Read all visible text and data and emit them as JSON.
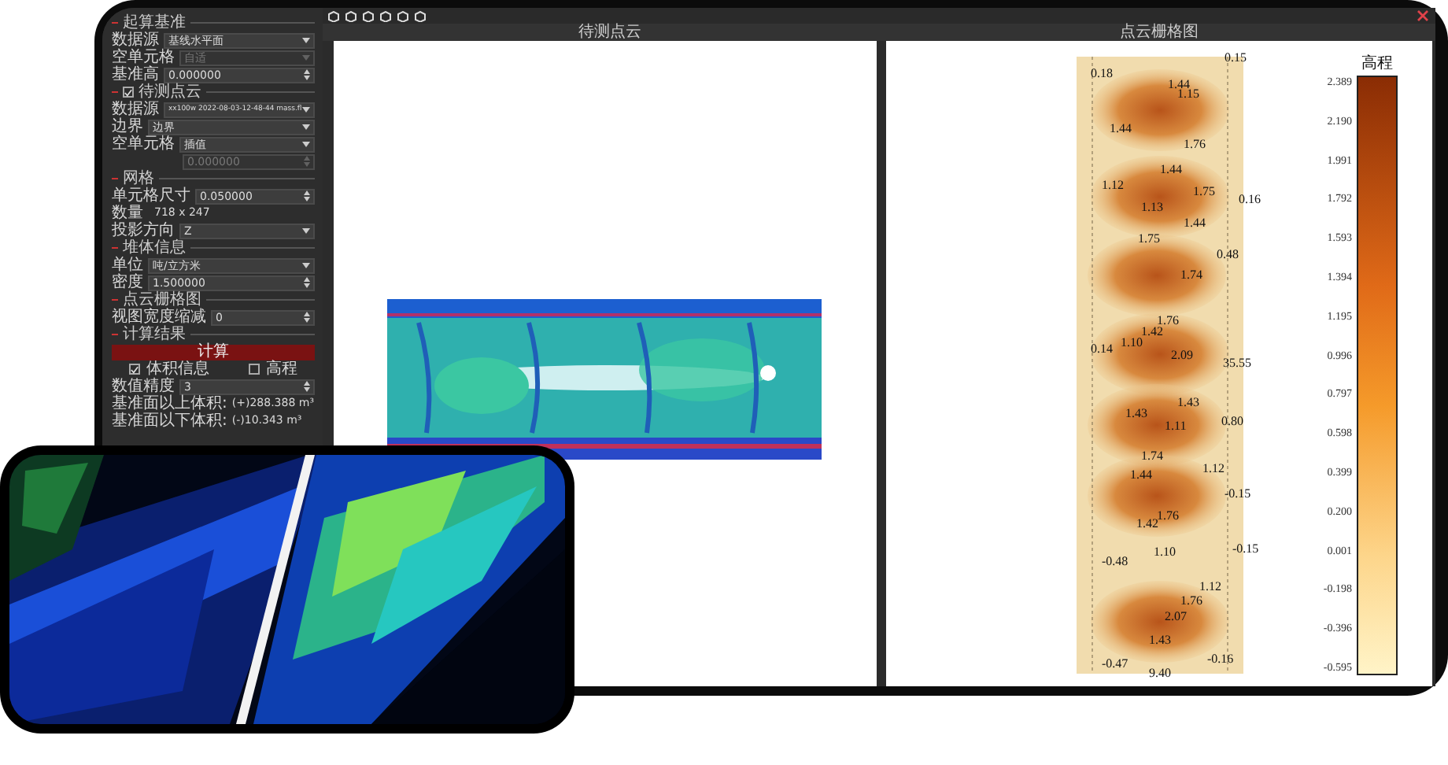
{
  "panel": {
    "items": [
      {
        "kind": "section",
        "title": "起算基准"
      },
      {
        "kind": "select",
        "label": "数据源",
        "value": "基线水平面",
        "disabled": false
      },
      {
        "kind": "select",
        "label": "空单元格",
        "value": "自适",
        "disabled": true
      },
      {
        "kind": "spin",
        "label": "基准高",
        "value": "0.000000",
        "disabled": false
      },
      {
        "kind": "check_section",
        "title": "待测点云",
        "checked": true
      },
      {
        "kind": "select",
        "label": "数据源",
        "value": "xx100w 2022-08-03-12-48-44 mass.fl",
        "disabled": false
      },
      {
        "kind": "select",
        "label": "边界",
        "value": "边界",
        "disabled": false
      },
      {
        "kind": "select",
        "label": "空单元格",
        "value": "插值",
        "disabled": false
      },
      {
        "kind": "spin",
        "value": "0.000000",
        "disabled": true
      },
      {
        "kind": "section",
        "title": "网格"
      },
      {
        "kind": "spin",
        "label": "单元格尺寸",
        "value": "0.050000",
        "disabled": false
      },
      {
        "kind": "text",
        "label": "数量",
        "value": "718 x 247"
      },
      {
        "kind": "select",
        "label": "投影方向",
        "value": "Z",
        "disabled": false
      },
      {
        "kind": "section",
        "title": "堆体信息"
      },
      {
        "kind": "select",
        "label": "单位",
        "value": "吨/立方米",
        "disabled": false
      },
      {
        "kind": "spin",
        "label": "密度",
        "value": "1.500000",
        "disabled": false
      },
      {
        "kind": "section",
        "title": "点云栅格图"
      },
      {
        "kind": "spin",
        "label": "视图宽度缩减",
        "value": "0",
        "disabled": false
      },
      {
        "kind": "section",
        "title": "计算结果"
      },
      {
        "kind": "button",
        "label": "计算"
      },
      {
        "kind": "checks",
        "options": [
          {
            "label": "体积信息",
            "checked": true
          },
          {
            "label": "高程",
            "checked": false
          }
        ]
      },
      {
        "kind": "spin",
        "label": "数值精度",
        "value": "3",
        "disabled": false
      },
      {
        "kind": "result",
        "label": "基准面以上体积:",
        "value": "(+)288.388 m³"
      },
      {
        "kind": "result",
        "label": "基准面以下体积:",
        "value": "(-)10.343 m³"
      }
    ]
  },
  "panes": [
    {
      "title": "待测点云"
    },
    {
      "title": "点云栅格图"
    }
  ],
  "map_labels": [
    "0.15",
    "0.18",
    "1.44",
    "1.15",
    "1.44",
    "1.76",
    "1.44",
    "1.12",
    "1.75",
    "0.16",
    "1.13",
    "1.44",
    "1.75",
    "0.48",
    "1.74",
    "1.76",
    "1.42",
    "1.10",
    "0.14",
    "2.09",
    "35.55",
    "1.43",
    "1.43",
    "1.11",
    "0.80",
    "1.74",
    "1.44",
    "1.12",
    "-0.15",
    "1.76",
    "1.42",
    "-0.15",
    "1.10",
    "-0.48",
    "1.12",
    "1.76",
    "2.07",
    "1.43",
    "-0.47",
    "9.40",
    "-0.16"
  ],
  "color_scale": {
    "title": "高程",
    "ticks": [
      "2.389",
      "2.190",
      "1.991",
      "1.792",
      "1.593",
      "1.394",
      "1.195",
      "0.996",
      "0.797",
      "0.598",
      "0.399",
      "0.200",
      "0.001",
      "-0.198",
      "-0.396",
      "-0.595"
    ]
  }
}
